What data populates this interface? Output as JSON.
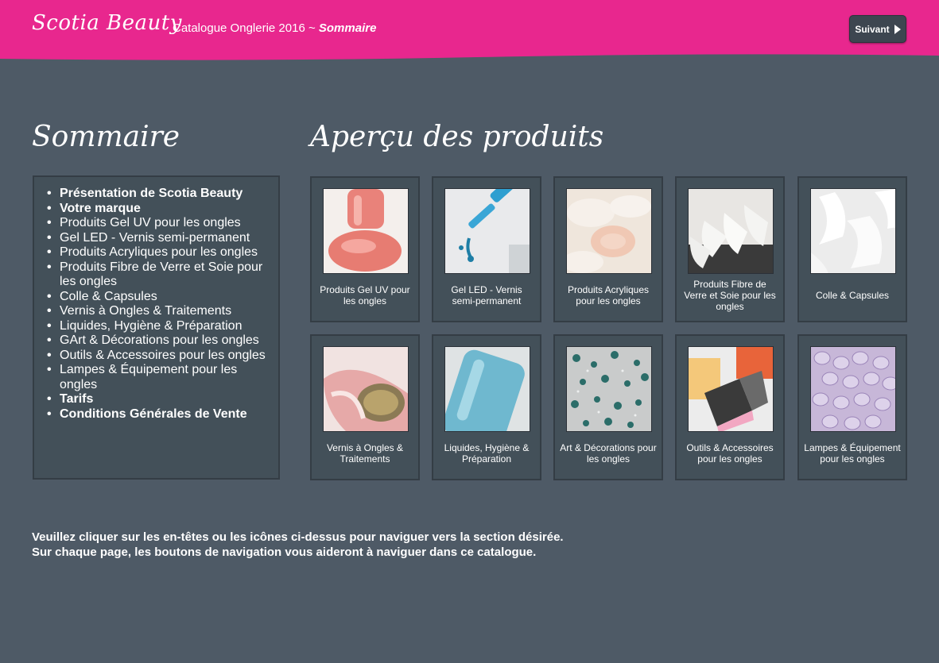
{
  "header": {
    "brand": "Scotia Beauty",
    "catalogue_title": "Catalogue Onglerie 2016 ~ ",
    "section": "Sommaire",
    "next_label": "Suivant",
    "accent_color": "#e8278e"
  },
  "sommaire": {
    "title": "Sommaire",
    "items": [
      {
        "label": "Présentation de Scotia Beauty",
        "bold": true
      },
      {
        "label": "Votre marque",
        "bold": true
      },
      {
        "label": "Produits Gel UV pour les ongles",
        "bold": false
      },
      {
        "label": "Gel LED - Vernis semi-permanent",
        "bold": false
      },
      {
        "label": "Produits Acryliques pour les ongles",
        "bold": false
      },
      {
        "label": "Produits Fibre de Verre et Soie pour les ongles",
        "bold": false
      },
      {
        "label": "Colle & Capsules",
        "bold": false
      },
      {
        "label": "Vernis à Ongles & Traitements",
        "bold": false
      },
      {
        "label": "Liquides, Hygiène & Préparation",
        "bold": false
      },
      {
        "label": "GArt & Décorations pour les ongles",
        "bold": false
      },
      {
        "label": "Outils & Accessoires pour les ongles",
        "bold": false
      },
      {
        "label": "Lampes & Équipement pour les ongles",
        "bold": false
      },
      {
        "label": "Tarifs",
        "bold": true
      },
      {
        "label": "Conditions Générales de Vente",
        "bold": true
      }
    ]
  },
  "apercu": {
    "title": "Aperçu des produits",
    "products": [
      {
        "label": "Produits Gel UV pour les ongles",
        "icon": "gel-uv-image"
      },
      {
        "label": "Gel LED - Vernis semi-permanent",
        "icon": "gel-led-image"
      },
      {
        "label": "Produits Acryliques pour les ongles",
        "icon": "acrylic-powder-image"
      },
      {
        "label": "Produits Fibre de Verre et Soie pour les ongles",
        "icon": "fiberglass-silk-image"
      },
      {
        "label": "Colle & Capsules",
        "icon": "nail-tips-image"
      },
      {
        "label": "Vernis à Ongles & Traitements",
        "icon": "nail-polish-image"
      },
      {
        "label": "Liquides, Hygiène & Préparation",
        "icon": "liquid-bottle-image"
      },
      {
        "label": "Art & Décorations pour les ongles",
        "icon": "rhinestones-image"
      },
      {
        "label": "Outils & Accessoires pour les ongles",
        "icon": "buffer-blocks-image"
      },
      {
        "label": "Lampes & Équipement pour les ongles",
        "icon": "uv-lamp-image"
      }
    ]
  },
  "instructions": {
    "line1": "Veuillez cliquer sur les en-têtes ou les icônes ci-dessus pour naviguer vers la section désirée.",
    "line2": "Sur chaque page, les boutons de navigation vous aideront à naviguer dans ce catalogue."
  }
}
